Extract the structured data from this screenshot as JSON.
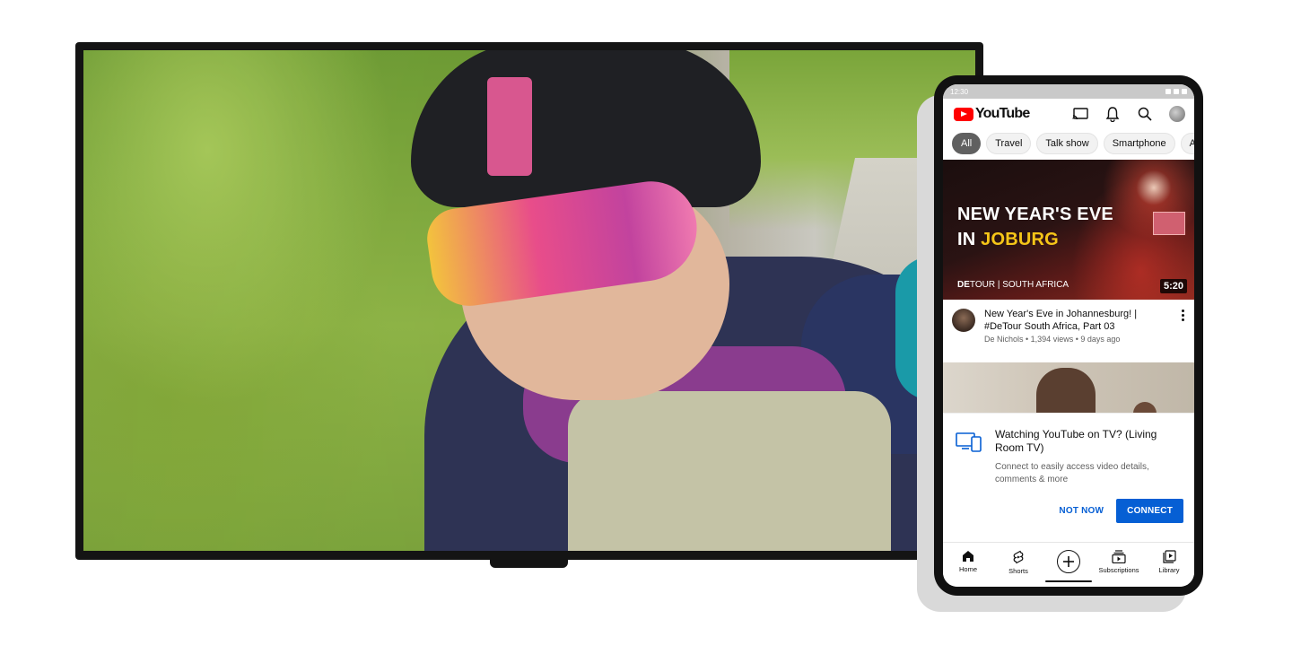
{
  "phone": {
    "status_time": "12:30",
    "app_name": "YouTube",
    "header_icons": [
      "cast-icon",
      "bell-icon",
      "search-icon",
      "account-avatar"
    ],
    "chips": [
      {
        "label": "All",
        "active": true
      },
      {
        "label": "Travel",
        "active": false
      },
      {
        "label": "Talk show",
        "active": false
      },
      {
        "label": "Smartphone",
        "active": false
      },
      {
        "label": "Ar",
        "active": false
      }
    ],
    "video": {
      "thumb_line1": "NEW YEAR'S EVE",
      "thumb_line2_a": "IN ",
      "thumb_line2_b": "JOBURG",
      "thumb_brand_bold": "DE",
      "thumb_brand_rest": "TOUR | SOUTH AFRICA",
      "duration": "5:20",
      "title": "New Year's Eve in Johannesburg! | #DeTour South Africa, Part 03",
      "subtitle": "De Nichols • 1,394 views • 9 days ago"
    },
    "prompt": {
      "title": "Watching YouTube on TV? (Living Room TV)",
      "description": "Connect to easily access video details, comments & more",
      "not_now": "NOT NOW",
      "connect": "CONNECT"
    },
    "nav": {
      "home": "Home",
      "shorts": "Shorts",
      "subscriptions": "Subscriptions",
      "library": "Library"
    }
  },
  "colors": {
    "brand_red": "#ff0000",
    "link_blue": "#065fd4",
    "highlight_yellow": "#f5c518"
  }
}
